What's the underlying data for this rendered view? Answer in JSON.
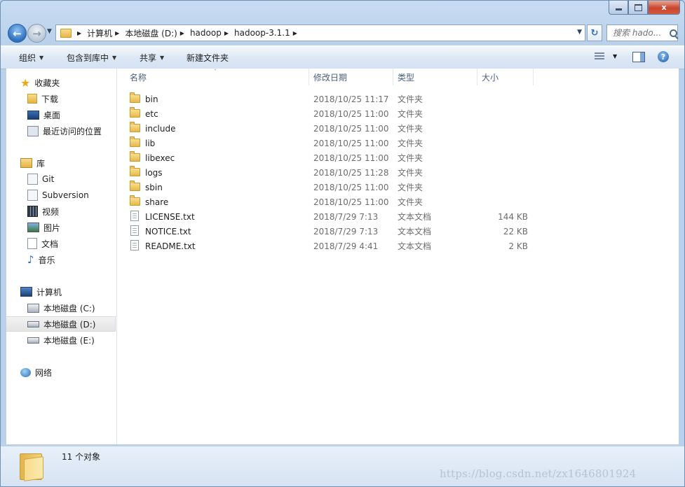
{
  "window": {
    "caption": {
      "minimize": "–",
      "maximize": "□",
      "close": "x"
    }
  },
  "nav": {
    "breadcrumbs": [
      "计算机",
      "本地磁盘 (D:)",
      "hadoop",
      "hadoop-3.1.1"
    ],
    "search_placeholder": "搜索 hado..."
  },
  "toolbar": {
    "organize": "组织",
    "include_in_library": "包含到库中",
    "share": "共享",
    "new_folder": "新建文件夹",
    "help": "?"
  },
  "sidebar": {
    "favorites": {
      "label": "收藏夹",
      "items": [
        "下载",
        "桌面",
        "最近访问的位置"
      ]
    },
    "libraries": {
      "label": "库",
      "items": [
        "Git",
        "Subversion",
        "视频",
        "图片",
        "文档",
        "音乐"
      ]
    },
    "computer": {
      "label": "计算机",
      "items": [
        "本地磁盘 (C:)",
        "本地磁盘 (D:)",
        "本地磁盘 (E:)"
      ],
      "selected": "本地磁盘 (D:)"
    },
    "network": {
      "label": "网络"
    }
  },
  "columns": {
    "name": "名称",
    "date": "修改日期",
    "type": "类型",
    "size": "大小"
  },
  "files": [
    {
      "name": "bin",
      "date": "2018/10/25 11:17",
      "type": "文件夹",
      "size": "",
      "kind": "folder"
    },
    {
      "name": "etc",
      "date": "2018/10/25 11:00",
      "type": "文件夹",
      "size": "",
      "kind": "folder"
    },
    {
      "name": "include",
      "date": "2018/10/25 11:00",
      "type": "文件夹",
      "size": "",
      "kind": "folder"
    },
    {
      "name": "lib",
      "date": "2018/10/25 11:00",
      "type": "文件夹",
      "size": "",
      "kind": "folder"
    },
    {
      "name": "libexec",
      "date": "2018/10/25 11:00",
      "type": "文件夹",
      "size": "",
      "kind": "folder"
    },
    {
      "name": "logs",
      "date": "2018/10/25 11:28",
      "type": "文件夹",
      "size": "",
      "kind": "folder"
    },
    {
      "name": "sbin",
      "date": "2018/10/25 11:00",
      "type": "文件夹",
      "size": "",
      "kind": "folder"
    },
    {
      "name": "share",
      "date": "2018/10/25 11:00",
      "type": "文件夹",
      "size": "",
      "kind": "folder"
    },
    {
      "name": "LICENSE.txt",
      "date": "2018/7/29 7:13",
      "type": "文本文档",
      "size": "144 KB",
      "kind": "text"
    },
    {
      "name": "NOTICE.txt",
      "date": "2018/7/29 7:13",
      "type": "文本文档",
      "size": "22 KB",
      "kind": "text"
    },
    {
      "name": "README.txt",
      "date": "2018/7/29 4:41",
      "type": "文本文档",
      "size": "2 KB",
      "kind": "text"
    }
  ],
  "status": {
    "count": "11 个对象",
    "watermark": "https://blog.csdn.net/zx1646801924"
  }
}
